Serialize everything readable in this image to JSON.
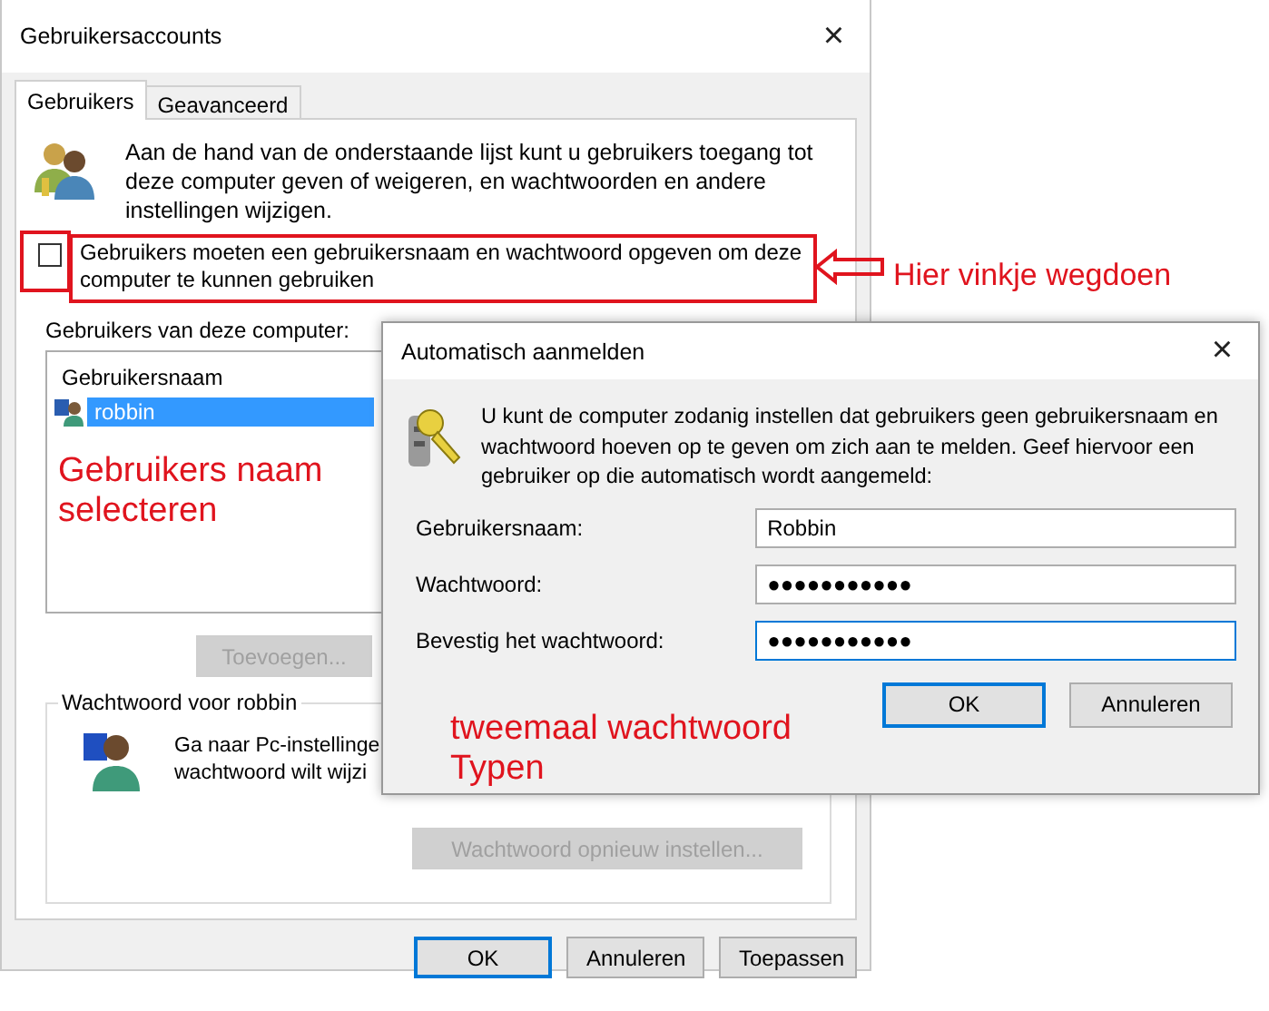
{
  "main_window": {
    "title": "Gebruikersaccounts",
    "close": "×",
    "tabs": [
      {
        "label": "Gebruikers",
        "selected": true
      },
      {
        "label": "Geavanceerd",
        "selected": false
      }
    ],
    "intro": "Aan de hand van de onderstaande lijst kunt u gebruikers toegang tot deze computer geven of weigeren, en wachtwoorden en andere instellingen wijzigen.",
    "require_login": {
      "label": "Gebruikers moeten een gebruikersnaam en wachtwoord opgeven om deze computer te kunnen gebruiken",
      "checked": false
    },
    "users_label": "Gebruikers van deze computer:",
    "users_table": {
      "columns": [
        "Gebruikersnaam"
      ],
      "rows": [
        {
          "name": "robbin",
          "selected": true
        }
      ]
    },
    "add_button": {
      "label": "Toevoegen...",
      "disabled": true
    },
    "password_group": {
      "title": "Wachtwoord voor robbin",
      "text_lines": [
        "Ga naar Pc-instellinge",
        "wachtwoord wilt wijzi"
      ],
      "reset_button": {
        "label": "Wachtwoord opnieuw instellen...",
        "disabled": true
      }
    },
    "buttons": [
      {
        "label": "OK",
        "default": true
      },
      {
        "label": "Annuleren",
        "default": false
      },
      {
        "label": "Toepassen",
        "default": false
      }
    ]
  },
  "autologon_dialog": {
    "title": "Automatisch aanmelden",
    "close": "×",
    "text": "U kunt de computer zodanig instellen dat gebruikers geen gebruikersnaam en wachtwoord hoeven op te geven om zich aan te melden. Geef hiervoor een gebruiker op die automatisch wordt aangemeld:",
    "fields": [
      {
        "label": "Gebruikersnaam:",
        "value": "Robbin",
        "focused": false
      },
      {
        "label": "Wachtwoord:",
        "value": "●●●●●●●●●●●",
        "focused": false
      },
      {
        "label": "Bevestig het wachtwoord:",
        "value": "●●●●●●●●●●●",
        "focused": true
      }
    ],
    "buttons": [
      {
        "label": "OK",
        "default": true
      },
      {
        "label": "Annuleren",
        "default": false
      }
    ]
  },
  "annotations": [
    {
      "text": "Hier vinkje wegdoen"
    },
    {
      "text": "Gebruikers naam selecteren"
    },
    {
      "text": "tweemaal wachtwoord Typen"
    }
  ]
}
